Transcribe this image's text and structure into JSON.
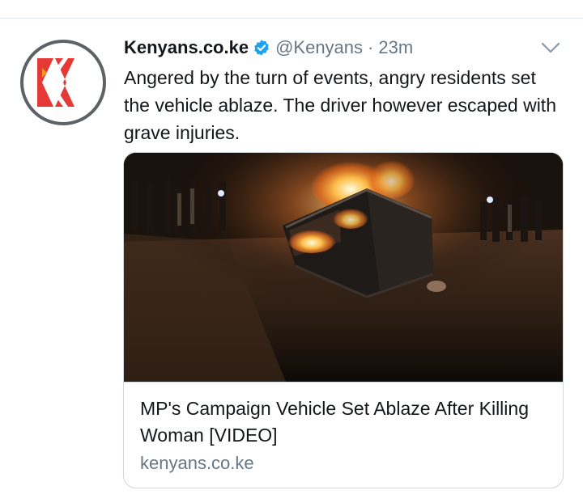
{
  "tweet": {
    "avatar_icon": "kenyans-k-logo-icon",
    "display_name": "Kenyans.co.ke",
    "verified_icon": "verified-badge-icon",
    "handle": "@Kenyans",
    "separator": "·",
    "time": "23m",
    "menu_icon": "chevron-down-icon",
    "text": "Angered by the turn of events, angry residents set the vehicle ablaze. The driver however escaped with grave injuries.",
    "card": {
      "image_description_icon": "burning-vehicle-photo",
      "title": "MP's Campaign Vehicle Set Ablaze After Killing Woman [VIDEO]",
      "domain": "kenyans.co.ke"
    }
  },
  "colors": {
    "brand_red": "#e53935",
    "verified_blue": "#1da1f2",
    "secondary_text": "#657786",
    "border": "#ccd6dd"
  }
}
